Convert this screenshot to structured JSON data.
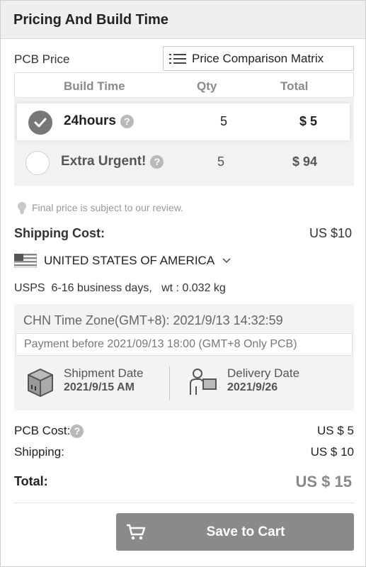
{
  "header": {
    "title": "Pricing And Build Time"
  },
  "pcb_price": {
    "label": "PCB Price",
    "matrix_button": "Price Comparison Matrix"
  },
  "build_table": {
    "columns": [
      "Build Time",
      "Qty",
      "Total"
    ],
    "rows": [
      {
        "build_time": "24hours",
        "qty": "5",
        "total": "$ 5",
        "selected": true
      },
      {
        "build_time": "Extra Urgent!",
        "qty": "5",
        "total": "$ 94",
        "selected": false
      }
    ],
    "help_glyph": "?"
  },
  "note": "Final price is subject to our review.",
  "shipping": {
    "label": "Shipping Cost:",
    "value": "US $10",
    "country": "UNITED STATES OF AMERICA",
    "method": "USPS  6-16 business days,   wt : 0.032 kg"
  },
  "timing": {
    "timezone": "CHN Time Zone(GMT+8): 2021/9/13 14:32:59",
    "payment_before": "Payment before 2021/09/13 18:00 (GMT+8 Only PCB)",
    "shipment_label": "Shipment Date",
    "shipment_value": "2021/9/15 AM",
    "delivery_label": "Delivery Date",
    "delivery_value": "2021/9/26"
  },
  "summary": {
    "pcb_cost_label": "PCB Cost:",
    "pcb_cost_value": "US $ 5",
    "shipping_label": "Shipping:",
    "shipping_value": "US $ 10",
    "total_label": "Total:",
    "total_value": "US $ 15"
  },
  "cart_button": {
    "label": "Save to Cart"
  },
  "icons": {
    "menu": "list-icon",
    "check": "check-icon",
    "help": "question-icon",
    "bulb": "lightbulb-icon",
    "flag": "us-flag-icon",
    "chevron": "chevron-down-icon",
    "box": "package-icon",
    "delivery": "delivery-person-icon",
    "cart": "cart-icon"
  },
  "colors": {
    "selected_radio": "#777777",
    "button_bg": "#8a8a8a",
    "total_text": "#888888"
  }
}
